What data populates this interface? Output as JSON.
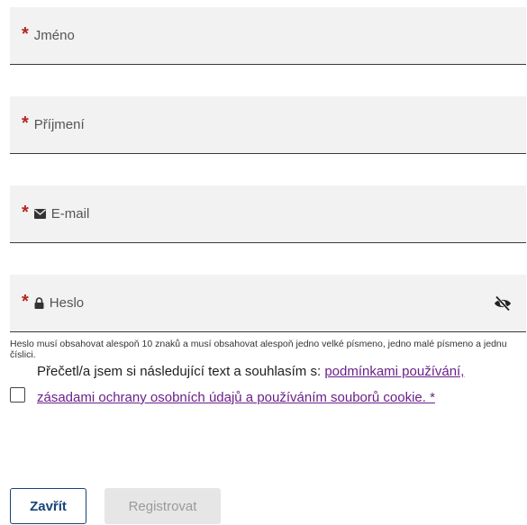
{
  "form": {
    "fields": [
      {
        "required_mark": "*",
        "placeholder": "Jméno"
      },
      {
        "required_mark": "*",
        "placeholder": "Příjmení"
      },
      {
        "required_mark": "*",
        "placeholder": "E-mail",
        "icon": "envelope-icon"
      },
      {
        "required_mark": "*",
        "placeholder": "Heslo",
        "icon": "lock-icon",
        "trailing_icon": "eye-off-icon"
      }
    ],
    "password_hint": "Heslo musí obsahovat alespoň 10 znaků a musí obsahovat alespoň jedno velké písmeno, jedno malé písmeno a jednu číslici.",
    "consent": {
      "text": "Přečetl/a jsem si následující text a souhlasím s: ",
      "link": "podmínkami používání, zásadami ochrany osobních údajů a používáním souborů cookie. *",
      "checked": false
    },
    "buttons": {
      "close_label": "Zavřít",
      "register_label": "Registrovat"
    }
  },
  "colors": {
    "required": "#b3261e",
    "link": "#6b1f8a",
    "primary_outline": "#16447a",
    "field_bg": "#f2f2f2",
    "disabled_bg": "#e6e6e6"
  }
}
